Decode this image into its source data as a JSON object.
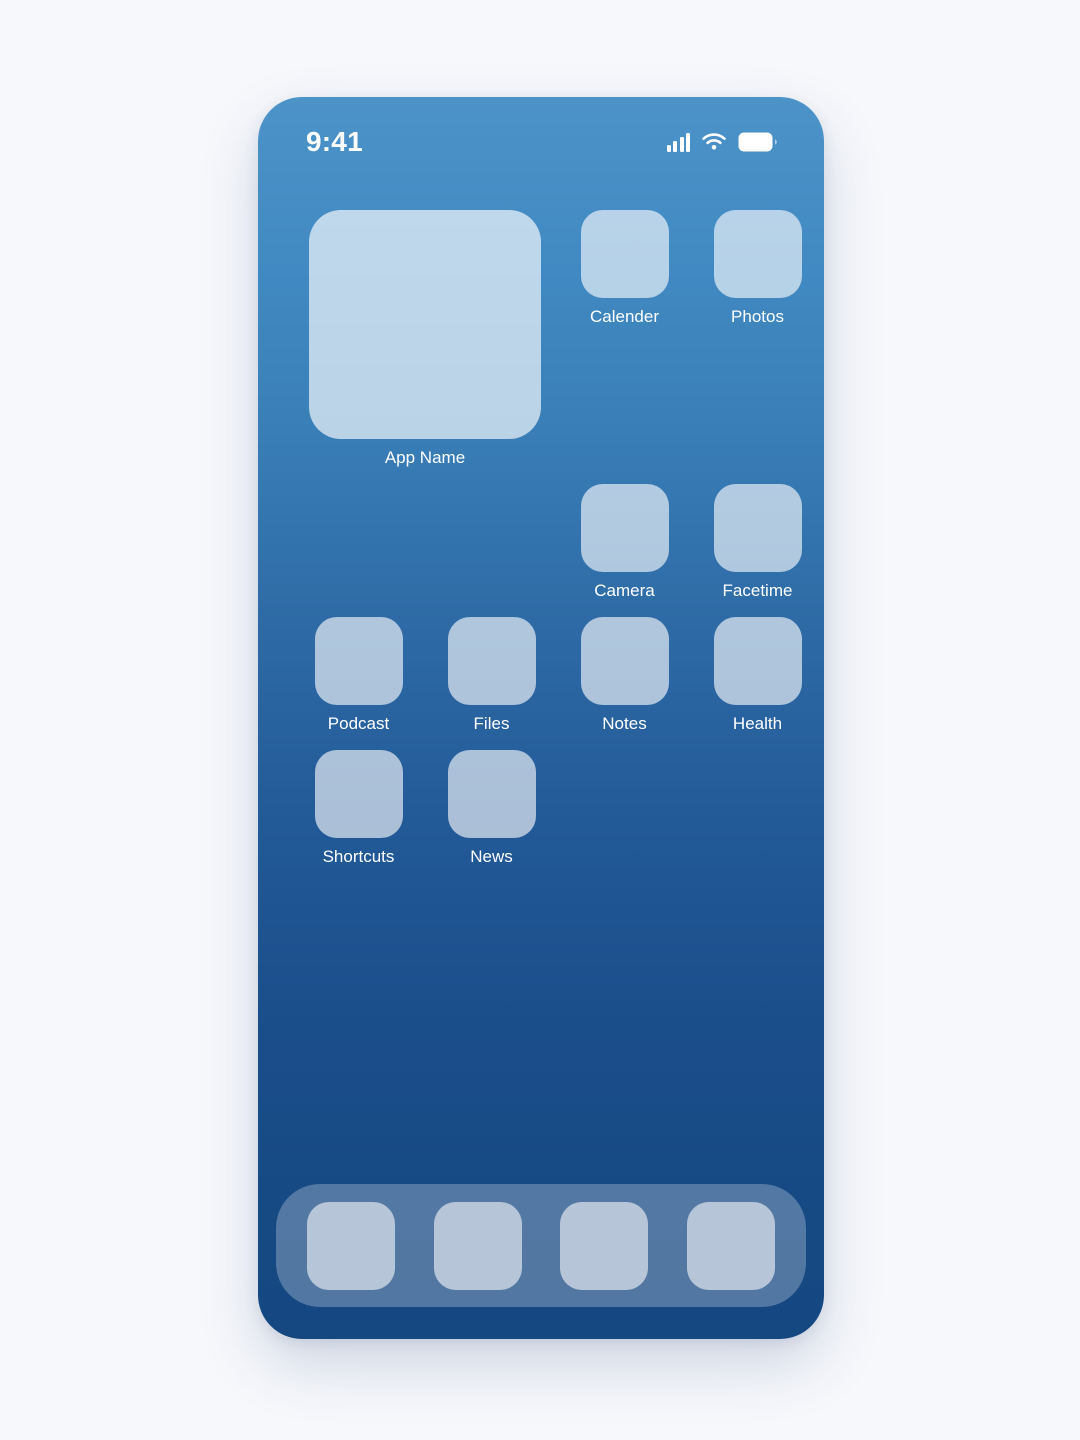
{
  "page": {
    "background_color": "#f7f8fc"
  },
  "phone": {
    "screen_gradient_top": "#4c93c8",
    "screen_gradient_bottom": "#154781",
    "tile_color": "#b6d3ea",
    "label_color": "#ffffff"
  },
  "status_bar": {
    "time": "9:41",
    "icons": [
      {
        "name": "cellular-signal-icon",
        "bars": 4
      },
      {
        "name": "wifi-icon",
        "strength": "full"
      },
      {
        "name": "battery-icon",
        "level": "full"
      }
    ]
  },
  "home_screen": {
    "rows": [
      {
        "cells": [
          {
            "type": "widget",
            "label": "App Name",
            "icon_name": "app-widget-placeholder"
          },
          {
            "type": "app",
            "label": "Calender",
            "icon_name": "calender-app-icon"
          },
          {
            "type": "app",
            "label": "Photos",
            "icon_name": "photos-app-icon"
          }
        ]
      },
      {
        "cells": [
          {
            "type": "app",
            "label": "Camera",
            "icon_name": "camera-app-icon"
          },
          {
            "type": "app",
            "label": "Facetime",
            "icon_name": "facetime-app-icon"
          }
        ]
      },
      {
        "cells": [
          {
            "type": "app",
            "label": "Podcast",
            "icon_name": "podcast-app-icon"
          },
          {
            "type": "app",
            "label": "Files",
            "icon_name": "files-app-icon"
          },
          {
            "type": "app",
            "label": "Notes",
            "icon_name": "notes-app-icon"
          },
          {
            "type": "app",
            "label": "Health",
            "icon_name": "health-app-icon"
          }
        ]
      },
      {
        "cells": [
          {
            "type": "app",
            "label": "Shortcuts",
            "icon_name": "shortcuts-app-icon"
          },
          {
            "type": "app",
            "label": "News",
            "icon_name": "news-app-icon"
          }
        ]
      }
    ],
    "widget": {
      "label": "App Name"
    },
    "row1": {
      "app1": "Calender",
      "app2": "Photos"
    },
    "row2": {
      "app1": "Camera",
      "app2": "Facetime"
    },
    "row3": {
      "app1": "Podcast",
      "app2": "Files",
      "app3": "Notes",
      "app4": "Health"
    },
    "row4": {
      "app1": "Shortcuts",
      "app2": "News"
    }
  },
  "dock": {
    "item_count": 4,
    "items": [
      {
        "icon_name": "dock-app-icon-1",
        "label": ""
      },
      {
        "icon_name": "dock-app-icon-2",
        "label": ""
      },
      {
        "icon_name": "dock-app-icon-3",
        "label": ""
      },
      {
        "icon_name": "dock-app-icon-4",
        "label": ""
      }
    ]
  }
}
